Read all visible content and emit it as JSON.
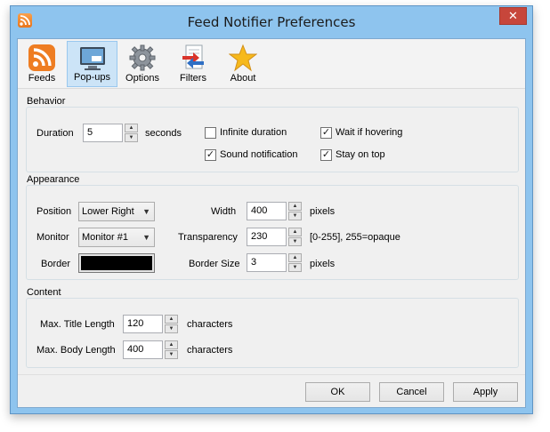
{
  "window": {
    "title": "Feed Notifier Preferences",
    "close_glyph": "✕"
  },
  "toolbar": {
    "items": [
      {
        "label": "Feeds",
        "icon": "rss-feed-icon"
      },
      {
        "label": "Pop-ups",
        "icon": "monitor-popup-icon"
      },
      {
        "label": "Options",
        "icon": "gear-icon"
      },
      {
        "label": "Filters",
        "icon": "filter-arrows-icon"
      },
      {
        "label": "About",
        "icon": "star-icon"
      }
    ],
    "active_index": 1
  },
  "behavior": {
    "title": "Behavior",
    "duration_label": "Duration",
    "duration_value": "5",
    "duration_unit": "seconds",
    "infinite_duration": {
      "label": "Infinite duration",
      "checked": false
    },
    "wait_if_hovering": {
      "label": "Wait if hovering",
      "checked": true
    },
    "sound_notification": {
      "label": "Sound notification",
      "checked": true
    },
    "stay_on_top": {
      "label": "Stay on top",
      "checked": true
    }
  },
  "appearance": {
    "title": "Appearance",
    "position_label": "Position",
    "position_value": "Lower Right",
    "monitor_label": "Monitor",
    "monitor_value": "Monitor #1",
    "border_label": "Border",
    "border_color": "#000000",
    "width_label": "Width",
    "width_value": "400",
    "width_unit": "pixels",
    "transparency_label": "Transparency",
    "transparency_value": "230",
    "transparency_hint": "[0-255], 255=opaque",
    "border_size_label": "Border Size",
    "border_size_value": "3",
    "border_size_unit": "pixels"
  },
  "content": {
    "title": "Content",
    "max_title_label": "Max. Title Length",
    "max_title_value": "120",
    "max_title_unit": "characters",
    "max_body_label": "Max. Body Length",
    "max_body_value": "400",
    "max_body_unit": "characters"
  },
  "buttons": {
    "ok": "OK",
    "cancel": "Cancel",
    "apply": "Apply"
  },
  "colors": {
    "title_bar": "#8ec4ee",
    "close_button": "#c7463b",
    "active_tab": "#cce4f7"
  }
}
